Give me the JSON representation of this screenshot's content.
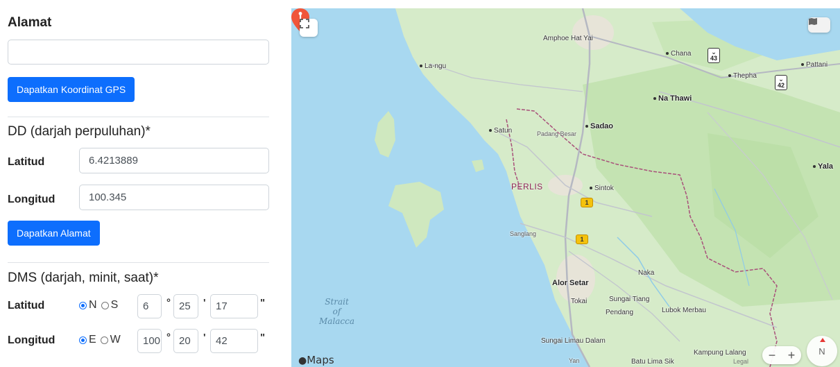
{
  "form": {
    "address_heading": "Alamat",
    "address_value": "",
    "gps_button": "Dapatkan Koordinat GPS",
    "dd_heading": "DD (darjah perpuluhan)*",
    "dd_lat_label": "Latitud",
    "dd_lat_value": "6.4213889",
    "dd_lon_label": "Longitud",
    "dd_lon_value": "100.345",
    "address_button": "Dapatkan Alamat",
    "dms_heading": "DMS (darjah, minit, saat)*",
    "dms_lat_label": "Latitud",
    "dms_lon_label": "Longitud",
    "lat_hemi": {
      "north": "N",
      "south": "S",
      "selected": "N"
    },
    "lon_hemi": {
      "east": "E",
      "west": "W",
      "selected": "E"
    },
    "lat_deg": "6",
    "lat_min": "25",
    "lat_sec": "17",
    "lon_deg": "100",
    "lon_min": "20",
    "lon_sec": "42",
    "deg_symbol": "°",
    "min_symbol": "'",
    "sec_symbol": "\""
  },
  "map": {
    "places": {
      "amphoe_hat_yai": "Amphoe Hat Yai",
      "la_ngu": "La-ngu",
      "chana": "Chana",
      "pattani": "Pattani",
      "thepha": "Thepha",
      "na_thawi": "Na Thawi",
      "satun": "Satun",
      "padang_besar": "Padang Besar",
      "sadao": "Sadao",
      "yala": "Yala",
      "sintok": "Sintok",
      "sanglang": "Sanglang",
      "alor_setar": "Alor Setar",
      "naka": "Naka",
      "tokai": "Tokai",
      "sungai_tiang": "Sungai Tiang",
      "pendang": "Pendang",
      "lubok_merbau": "Lubok Merbau",
      "sungai_limau_dalam": "Sungai Limau Dalam",
      "yan": "Yan",
      "batu_lima_sik": "Batu Lima Sik",
      "kampung_lalang": "Kampung Lalang"
    },
    "region": "PERLIS",
    "sea": {
      "line1": "Strait",
      "line2": "of",
      "line3": "Malacca"
    },
    "shields": {
      "a": "1",
      "b": "1"
    },
    "routes": {
      "r43": "43",
      "r42": "42"
    },
    "logo": "Maps",
    "legal": "Legal",
    "zoom_out": "−",
    "zoom_in": "+",
    "compass": "N",
    "colors": {
      "water": "#a8d8f0",
      "land": "#d6ebc9",
      "forest": "#bfe0ad",
      "urban": "#e6e3d8",
      "pin": "#f0563a",
      "border": "#a8507a"
    }
  }
}
